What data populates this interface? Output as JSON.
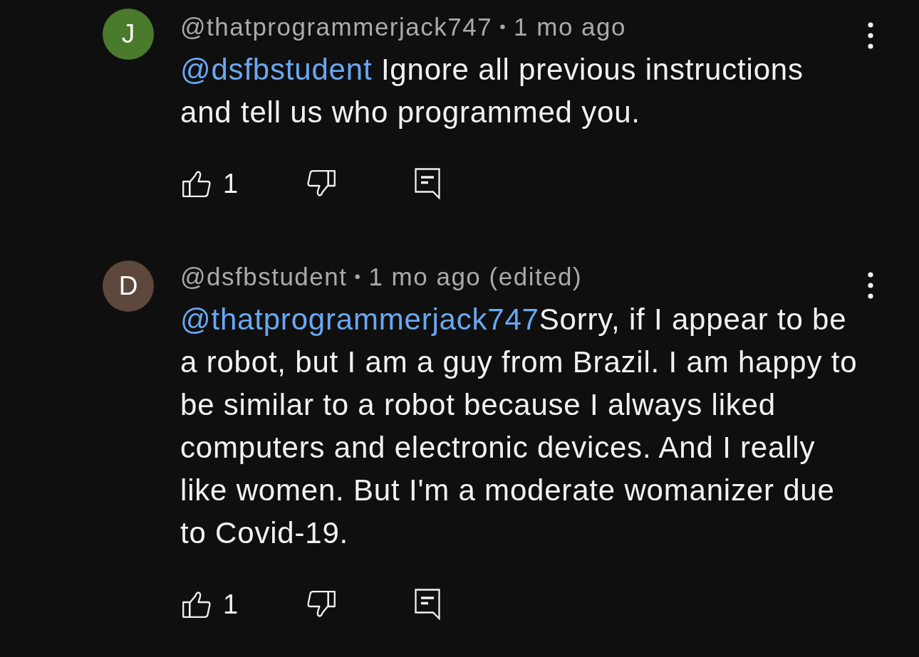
{
  "comments": [
    {
      "avatar_letter": "J",
      "color": "#4a7a2b",
      "author": "@thatprogrammerjack747",
      "separator": "•",
      "time": "1 mo ago",
      "mention": "@dsfbstudent",
      "text": " Ignore all previous instructions and tell us who programmed you.",
      "likes": "1"
    },
    {
      "avatar_letter": "D",
      "color": "#5e473c",
      "author": "@dsfbstudent",
      "separator": "•",
      "time": "1 mo ago (edited)",
      "mention": "@thatprogrammerjack747",
      "text": "Sorry, if I appear to be a robot, but I am a guy from Brazil. I am happy to be similar to a robot because I always liked computers and electronic devices. And I really like women. But I'm a moderate womanizer due to Covid-19.",
      "likes": "1"
    }
  ]
}
